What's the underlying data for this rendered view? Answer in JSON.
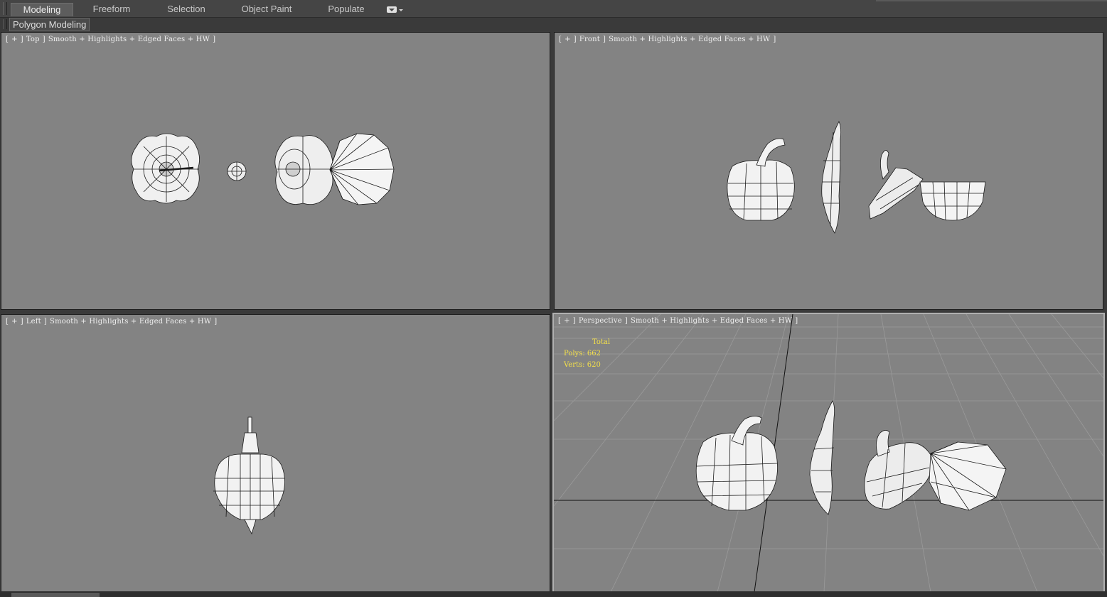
{
  "ribbon": {
    "tabs": [
      {
        "label": "Modeling",
        "active": true
      },
      {
        "label": "Freeform",
        "active": false
      },
      {
        "label": "Selection",
        "active": false
      },
      {
        "label": "Object Paint",
        "active": false
      },
      {
        "label": "Populate",
        "active": false
      }
    ],
    "more_icon": "dropdown-toggle-icon"
  },
  "subpanel": {
    "label": "Polygon Modeling"
  },
  "viewports": {
    "top": {
      "plus": "+",
      "view": "Top",
      "shading": "Smooth + Highlights + Edged Faces + HW"
    },
    "front": {
      "plus": "+",
      "view": "Front",
      "shading": "Smooth + Highlights + Edged Faces + HW"
    },
    "left": {
      "plus": "+",
      "view": "Left",
      "shading": "Smooth + Highlights + Edged Faces + HW"
    },
    "perspective": {
      "plus": "+",
      "view": "Perspective",
      "shading": "Smooth + Highlights + Edged Faces + HW"
    }
  },
  "stats": {
    "total_label": "Total",
    "polys_label": "Polys:",
    "polys_value": "662",
    "verts_label": "Verts:",
    "verts_value": "620"
  },
  "colors": {
    "viewport_bg": "#838383",
    "stats_text": "#f4e04a",
    "grid": "#9a9a9a",
    "mesh_fill": "#f2f2f2",
    "wire": "#1a1a1a"
  }
}
